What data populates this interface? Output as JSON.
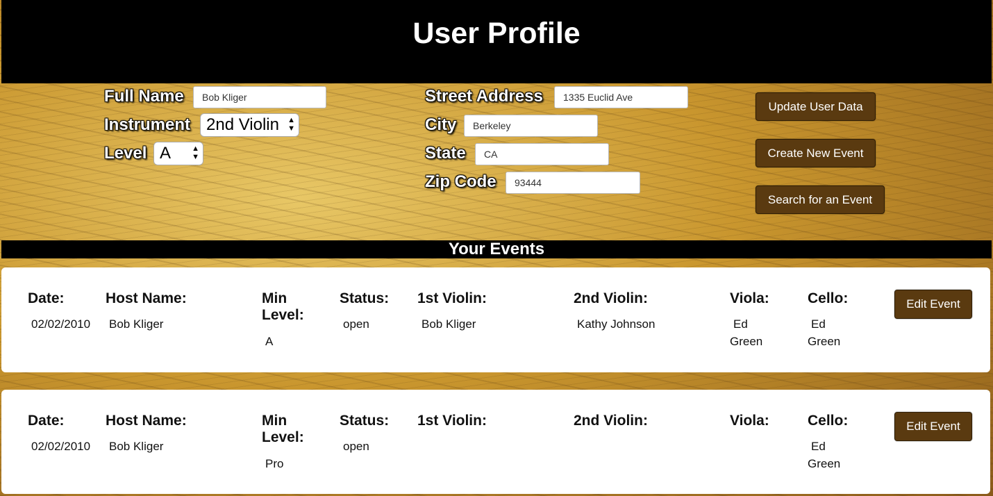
{
  "header": {
    "title": "User Profile"
  },
  "profile": {
    "full_name_label": "Full Name",
    "full_name": "Bob Kliger",
    "instrument_label": "Instrument",
    "instrument": "2nd Violin",
    "level_label": "Level",
    "level": "A",
    "street_label": "Street Address",
    "street": "1335 Euclid Ave",
    "city_label": "City",
    "city": "Berkeley",
    "state_label": "State",
    "state": "CA",
    "zip_label": "Zip Code",
    "zip": "93444"
  },
  "actions": {
    "update": "Update User Data",
    "create": "Create New Event",
    "search": "Search for an Event"
  },
  "events_heading": "Your Events",
  "event_headers": {
    "date": "Date:",
    "host": "Host Name:",
    "min_level_1": "Min",
    "min_level_2": "Level:",
    "status": "Status:",
    "violin1": "1st Violin:",
    "violin2": "2nd Violin:",
    "viola": "Viola:",
    "cello": "Cello:"
  },
  "events": [
    {
      "date": "02/02/2010",
      "host": "Bob Kliger",
      "min_level": "A",
      "status": "open",
      "violin1": "Bob Kliger",
      "violin2": "Kathy Johnson",
      "viola_1": "Ed",
      "viola_2": "Green",
      "cello_1": "Ed",
      "cello_2": "Green",
      "edit_label": "Edit Event"
    },
    {
      "date": "02/02/2010",
      "host": "Bob Kliger",
      "min_level": "Pro",
      "status": "open",
      "violin1": "",
      "violin2": "",
      "viola_1": "",
      "viola_2": "",
      "cello_1": "Ed",
      "cello_2": "Green",
      "edit_label": "Edit Event"
    }
  ],
  "icons": {
    "select_arrows": "updown-arrows-icon"
  }
}
